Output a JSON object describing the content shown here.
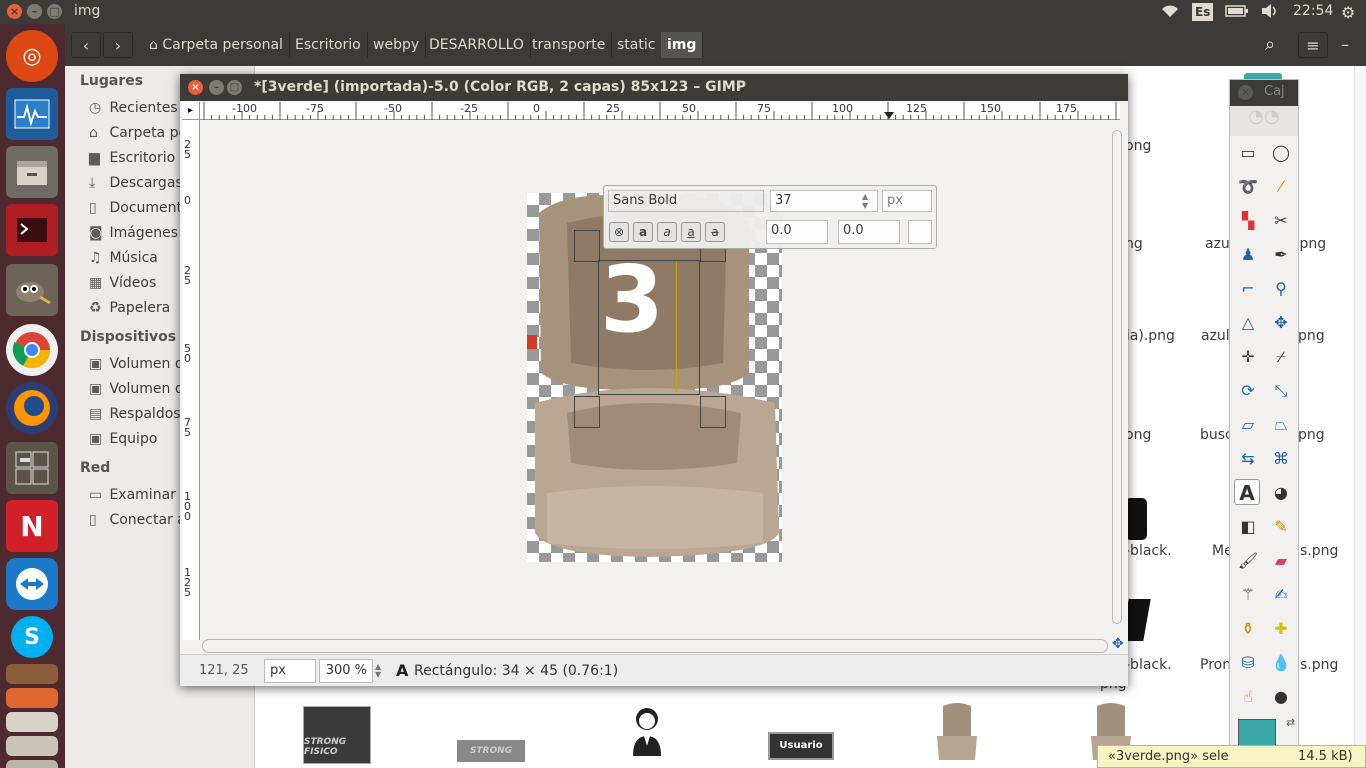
{
  "topbar": {
    "window_title": "img",
    "keyboard": "Es",
    "time": "22:54"
  },
  "nautilus": {
    "breadcrumbs": [
      "Carpeta personal",
      "Escritorio",
      "webpy",
      "DESARROLLO",
      "transporte",
      "static",
      "img"
    ],
    "sidebar": {
      "lugares_header": "Lugares",
      "lugares": [
        "Recientes",
        "Carpeta pe",
        "Escritorio",
        "Descargas",
        "Documento",
        "Imágenes",
        "Música",
        "Vídeos",
        "Papelera"
      ],
      "dispositivos_header": "Dispositivos",
      "dispositivos": [
        "Volumen d",
        "Volumen d",
        "Respaldos",
        "Equipo"
      ],
      "red_header": "Red",
      "red": [
        "Examinar r",
        "Conectar a"
      ]
    },
    "files": [
      "ong",
      "ng",
      "azu",
      ".png",
      "bia).png",
      "azul",
      "a.png",
      "ong",
      "busc",
      "a.png",
      "-black.",
      "Mem",
      "s.png",
      "-black.",
      "Pron",
      "s.png",
      "png"
    ],
    "thumb_labels": {
      "strong1": "STRONG FISICO",
      "strong2": "STRONG FISICO",
      "usuario": "Usuario"
    },
    "status": "«3verde.png» sele",
    "status_size": "14.5 kB)"
  },
  "gimp": {
    "title": "*[3verde] (importada)-5.0 (Color RGB, 2 capas) 85x123 – GIMP",
    "hruler_labels": [
      "-100",
      "-75",
      "-50",
      "-25",
      "0",
      "25",
      "50",
      "75",
      "100",
      "125",
      "150",
      "175"
    ],
    "vruler_labels": [
      "2\n5",
      "0",
      "2\n5",
      "5\n0",
      "7\n5",
      "1\n0\n0",
      "1\n2\n5"
    ],
    "canvas_text": "3",
    "text_toolbox": {
      "font": "Sans Bold",
      "size": "37",
      "unit": "px",
      "kerning": "0.0",
      "baseline": "0.0"
    },
    "status": {
      "coords": "121, 25",
      "unit": "px",
      "zoom": "300 %",
      "message": "Rectángulo: 34 × 45  (0.76:1)"
    }
  },
  "toolbox": {
    "title": "Caj"
  },
  "colors": {
    "accent": "#e95420",
    "fg_color": "#3aa7a8",
    "titlebar": "#3c3b37"
  }
}
